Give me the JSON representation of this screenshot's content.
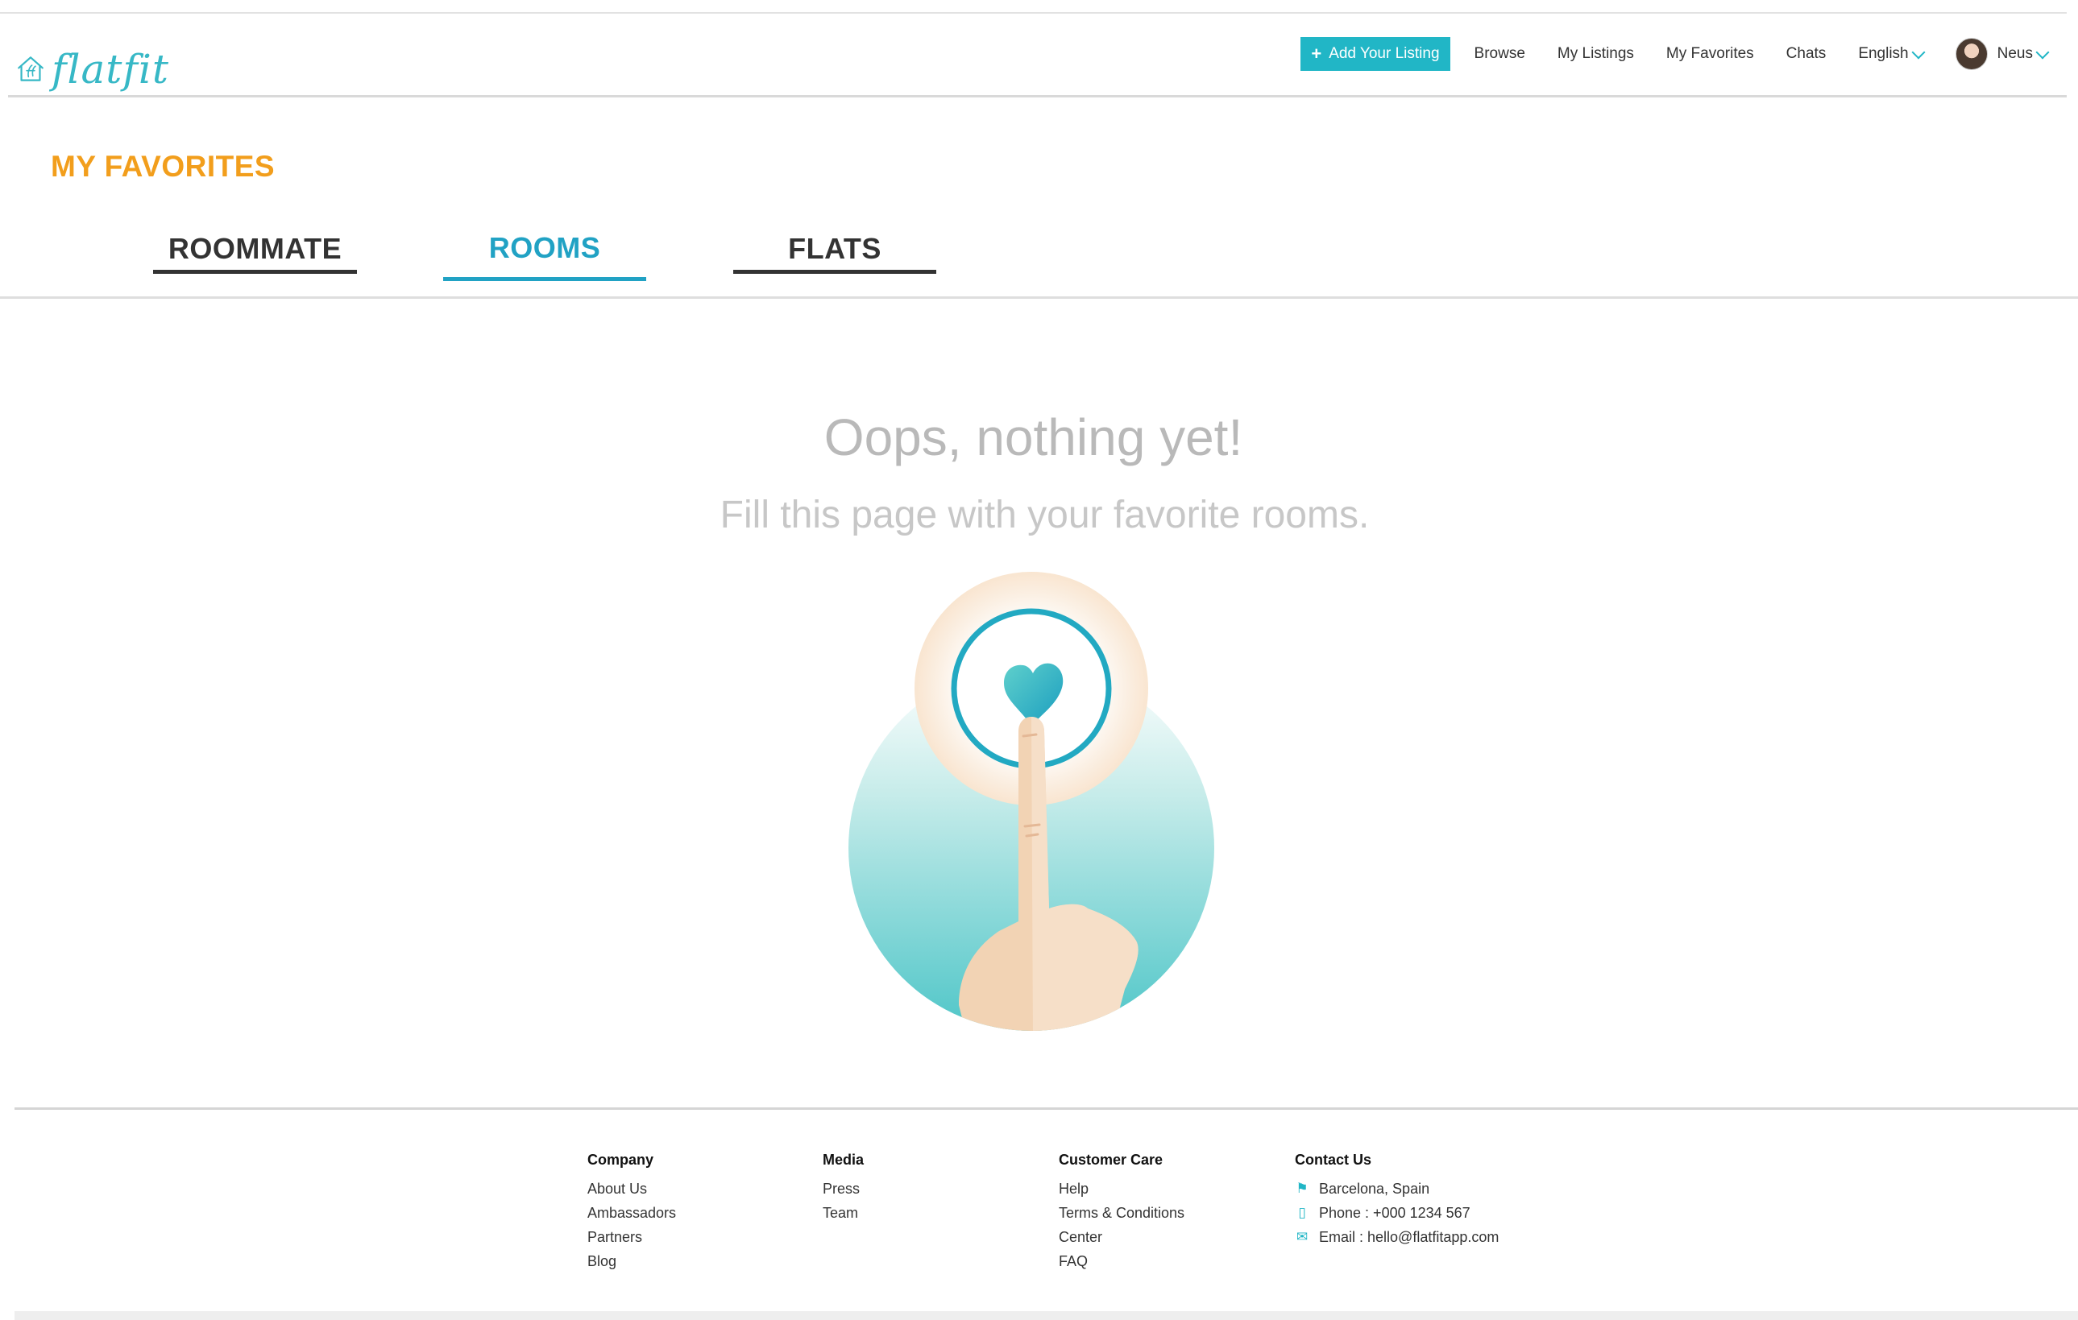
{
  "brand": {
    "name": "flatfit",
    "accent_color": "#21b6c6",
    "title_color": "#f29e1c"
  },
  "header": {
    "add_listing_label": "Add Your Listing",
    "nav": [
      "Browse",
      "My Listings",
      "My Favorites",
      "Chats"
    ],
    "language": "English",
    "user_name": "Neus"
  },
  "page": {
    "title": "MY FAVORITES",
    "tabs": [
      {
        "label": "ROOMMATE",
        "active": false
      },
      {
        "label": "ROOMS",
        "active": true
      },
      {
        "label": "FLATS",
        "active": false
      }
    ]
  },
  "empty_state": {
    "title": "Oops, nothing yet!",
    "subtitle": "Fill this page with your favorite rooms."
  },
  "footer": {
    "company": {
      "heading": "Company",
      "items": [
        "About Us",
        "Ambassadors",
        "Partners",
        "Blog"
      ]
    },
    "media": {
      "heading": "Media",
      "items": [
        "Press",
        "Team"
      ]
    },
    "customer_care": {
      "heading": "Customer Care",
      "items": [
        "Help",
        "Terms & Conditions",
        "Center",
        "FAQ"
      ]
    },
    "contact": {
      "heading": "Contact Us",
      "location": "Barcelona, Spain",
      "phone": "Phone : +000 1234 567",
      "email": "Email : hello@flatfitapp.com"
    }
  }
}
